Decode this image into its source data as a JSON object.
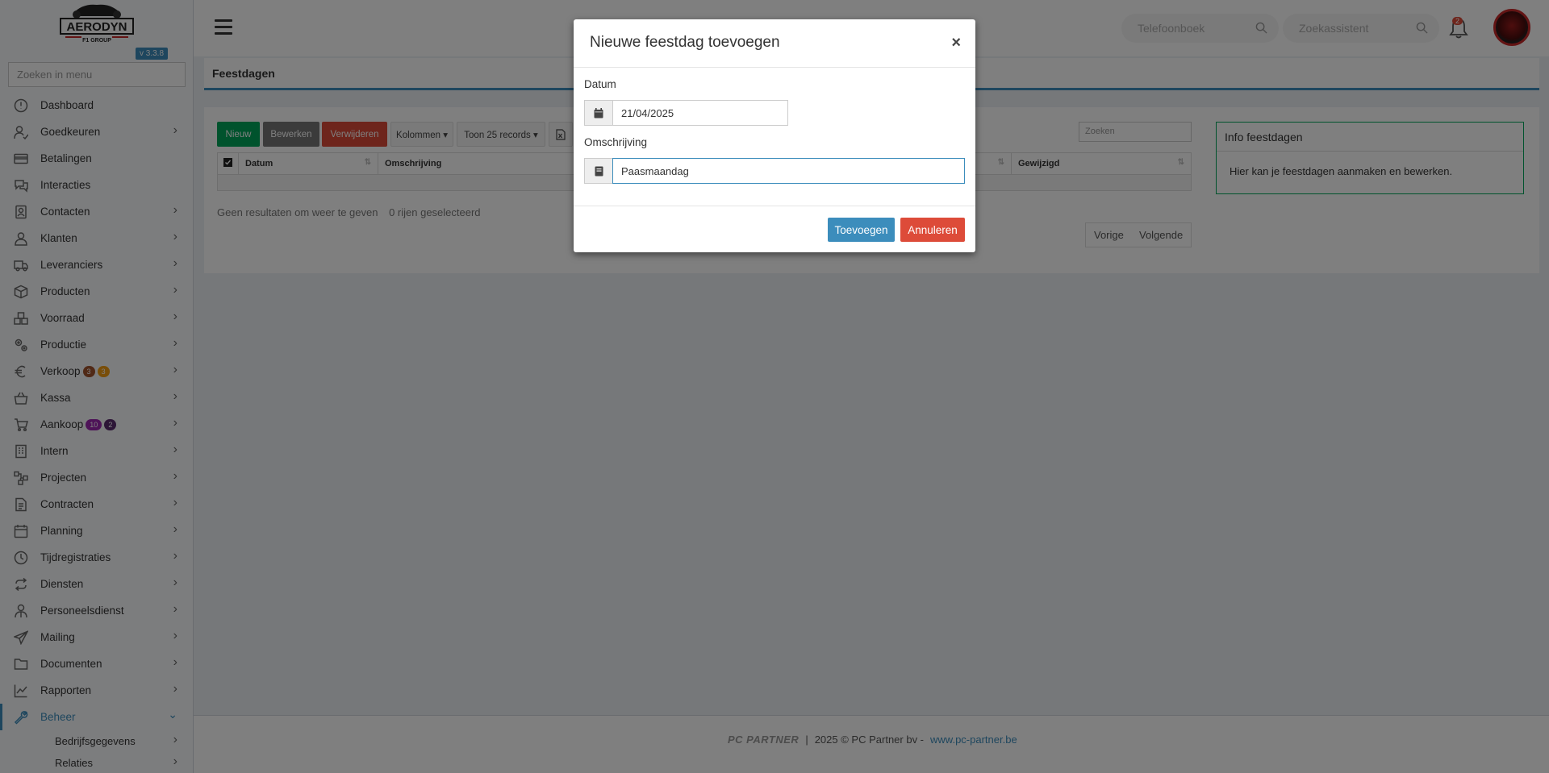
{
  "sidebar": {
    "logo_text": "AERODYN",
    "logo_subtext": "F1 GROUP",
    "version": "v 3.3.8",
    "search_placeholder": "Zoeken in menu",
    "items": [
      {
        "label": "Dashboard",
        "icon": "dashboard-icon",
        "has_children": false
      },
      {
        "label": "Goedkeuren",
        "icon": "user-check-icon",
        "has_children": true
      },
      {
        "label": "Betalingen",
        "icon": "credit-card-icon",
        "has_children": false
      },
      {
        "label": "Interacties",
        "icon": "chat-icon",
        "has_children": false
      },
      {
        "label": "Contacten",
        "icon": "contacts-icon",
        "has_children": true
      },
      {
        "label": "Klanten",
        "icon": "user-icon",
        "has_children": true
      },
      {
        "label": "Leveranciers",
        "icon": "truck-icon",
        "has_children": true
      },
      {
        "label": "Producten",
        "icon": "box-icon",
        "has_children": true
      },
      {
        "label": "Voorraad",
        "icon": "boxes-icon",
        "has_children": true
      },
      {
        "label": "Productie",
        "icon": "cogs-icon",
        "has_children": true
      },
      {
        "label": "Verkoop",
        "icon": "euro-icon",
        "has_children": true,
        "badges": [
          {
            "text": "3",
            "color": "#a0522d"
          },
          {
            "text": "3",
            "color": "#f39c12"
          }
        ]
      },
      {
        "label": "Kassa",
        "icon": "basket-icon",
        "has_children": true
      },
      {
        "label": "Aankoop",
        "icon": "cart-icon",
        "has_children": true,
        "badges": [
          {
            "text": "10",
            "color": "#9c27b0"
          },
          {
            "text": "2",
            "color": "#5b2c6f"
          }
        ]
      },
      {
        "label": "Intern",
        "icon": "building-icon",
        "has_children": true
      },
      {
        "label": "Projecten",
        "icon": "project-icon",
        "has_children": true
      },
      {
        "label": "Contracten",
        "icon": "contract-icon",
        "has_children": true
      },
      {
        "label": "Planning",
        "icon": "calendar-icon",
        "has_children": true
      },
      {
        "label": "Tijdregistraties",
        "icon": "clock-icon",
        "has_children": true
      },
      {
        "label": "Diensten",
        "icon": "repeat-icon",
        "has_children": true
      },
      {
        "label": "Personeelsdienst",
        "icon": "staff-icon",
        "has_children": true
      },
      {
        "label": "Mailing",
        "icon": "paper-plane-icon",
        "has_children": true
      },
      {
        "label": "Documenten",
        "icon": "folder-icon",
        "has_children": true
      },
      {
        "label": "Rapporten",
        "icon": "chart-line-icon",
        "has_children": true
      },
      {
        "label": "Beheer",
        "icon": "wrench-icon",
        "has_children": true,
        "active": true
      }
    ],
    "sub_items": [
      {
        "label": "Bedrijfsgegevens"
      },
      {
        "label": "Relaties"
      }
    ]
  },
  "header": {
    "phonebook_placeholder": "Telefoonboek",
    "assistant_placeholder": "Zoekassistent",
    "notification_count": "2"
  },
  "page": {
    "title": "Feestdagen",
    "toolbar": {
      "new_label": "Nieuw",
      "edit_label": "Bewerken",
      "delete_label": "Verwijderen",
      "columns_label": "Kolommen ▾",
      "records_label": "Toon 25 records ▾"
    },
    "search_placeholder": "Zoeken",
    "columns": [
      "Datum",
      "Omschrijving",
      "Gewijzigd"
    ],
    "empty_text": "Geen resultaten om weer te geven",
    "selected_text": "0 rijen geselecteerd",
    "prev_label": "Vorige",
    "next_label": "Volgende",
    "info_title": "Info feestdagen",
    "info_text": "Hier kan je feestdagen aanmaken en bewerken."
  },
  "footer": {
    "logo_text": "PC PARTNER",
    "copyright": "2025 © PC Partner bv -",
    "link": "www.pc-partner.be"
  },
  "modal": {
    "title": "Nieuwe feestdag toevoegen",
    "close": "×",
    "date_label": "Datum",
    "date_value": "21/04/2025",
    "desc_label": "Omschrijving",
    "desc_value": "Paasmaandag",
    "submit_label": "Toevoegen",
    "cancel_label": "Annuleren"
  },
  "colors": {
    "primary": "#3c8dbc",
    "success": "#00a65a",
    "danger": "#dd4b39",
    "gray": "#777777"
  }
}
